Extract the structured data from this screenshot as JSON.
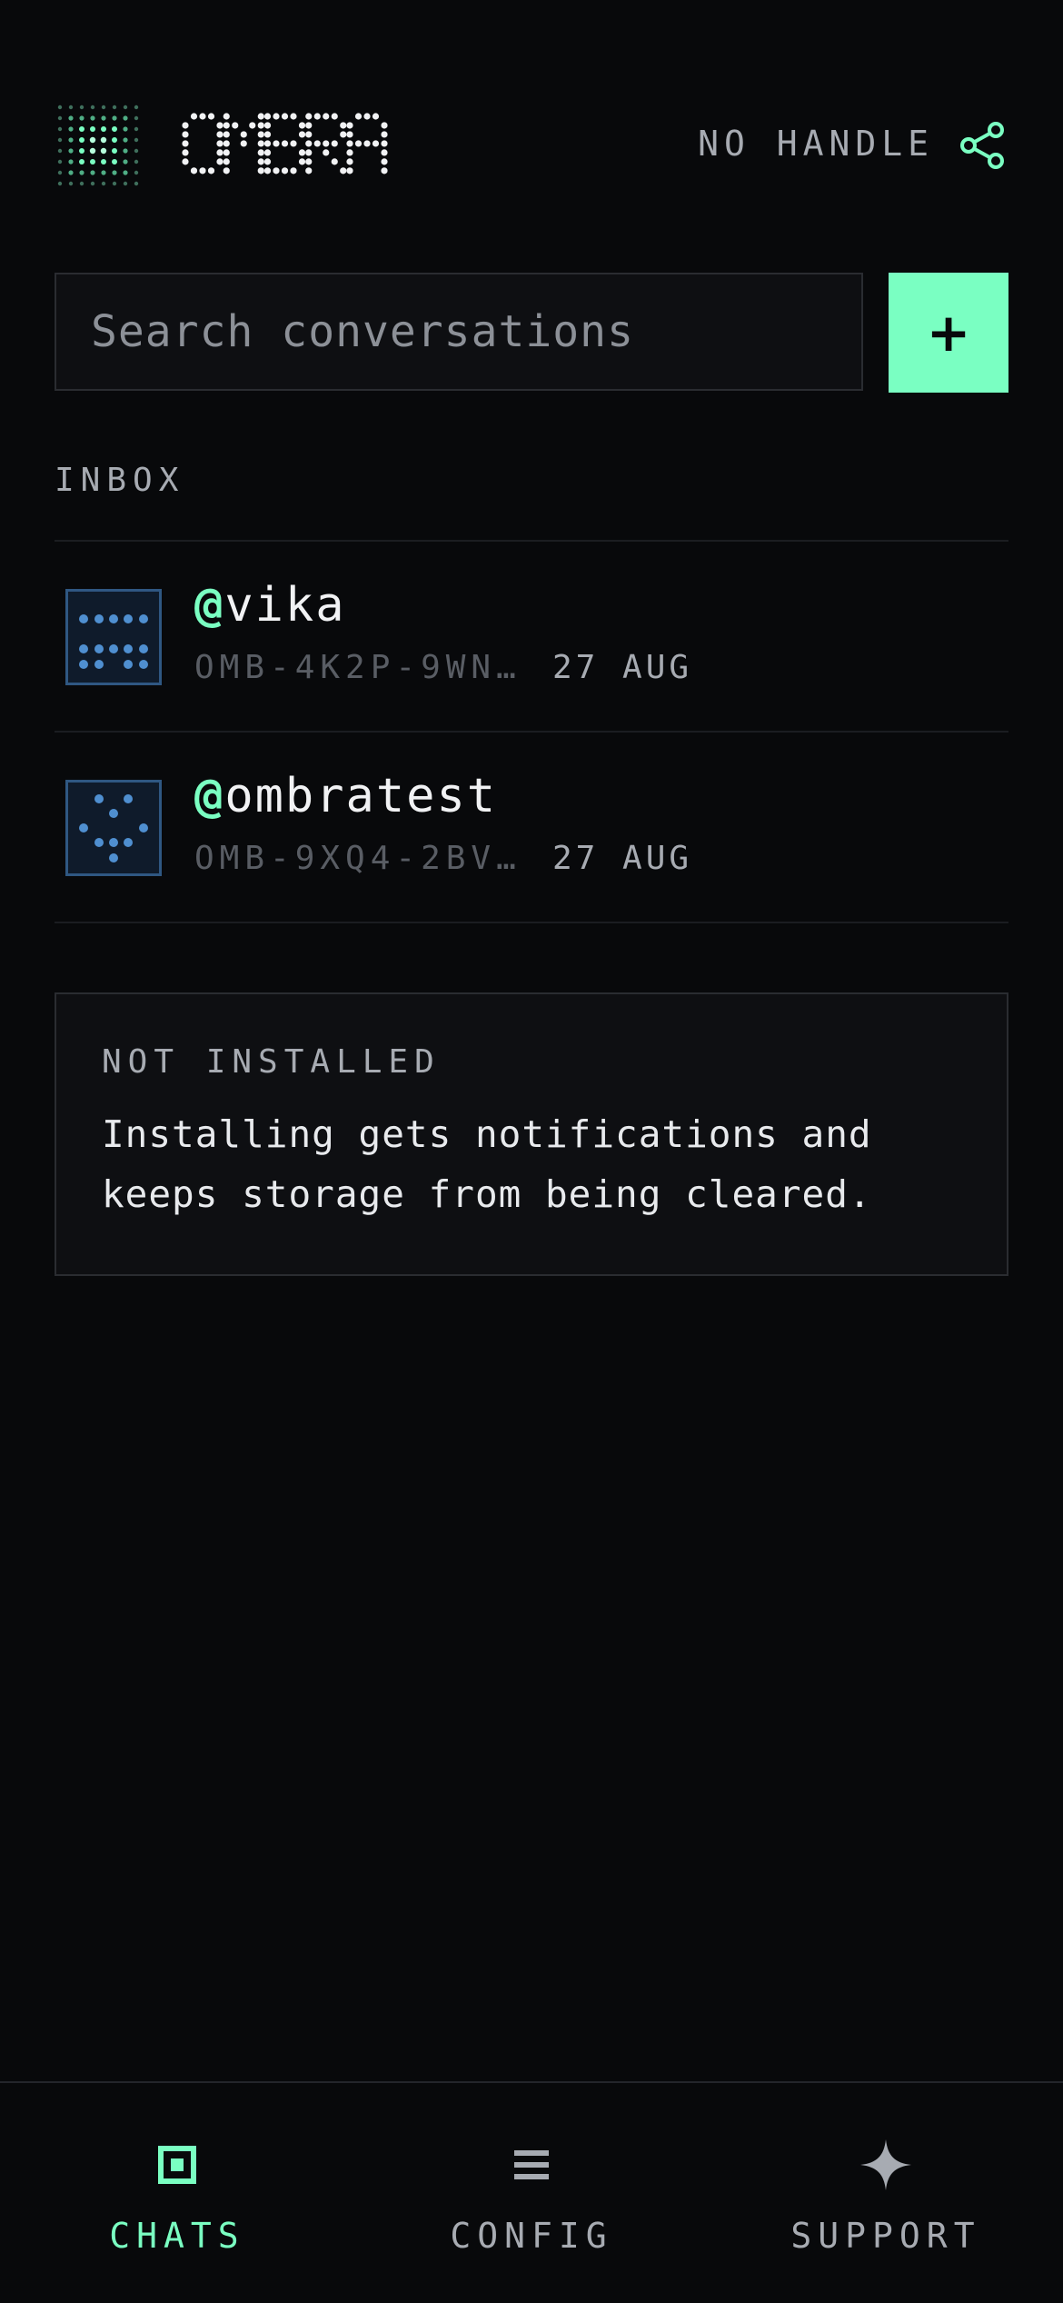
{
  "header": {
    "brand": "OMBRA",
    "handle_label": "NO HANDLE",
    "share_icon": "share-icon",
    "accent_color": "#7affc2"
  },
  "search": {
    "placeholder": "Search conversations",
    "value": "",
    "new_button_label": "+"
  },
  "inbox": {
    "label": "INBOX",
    "conversations": [
      {
        "at": "@",
        "name": "vika",
        "id": "OMB-4K2P-9WNR-…",
        "date": "27 AUG"
      },
      {
        "at": "@",
        "name": "ombratest",
        "id": "OMB-9XQ4-2BVT-…",
        "date": "27 AUG"
      }
    ]
  },
  "notice": {
    "title": "NOT INSTALLED",
    "body": "Installing gets notifications and keeps storage from being cleared."
  },
  "nav": {
    "items": [
      {
        "label": "CHATS",
        "icon": "chat-square-icon",
        "active": true
      },
      {
        "label": "CONFIG",
        "icon": "menu-lines-icon",
        "active": false
      },
      {
        "label": "SUPPORT",
        "icon": "sparkle-icon",
        "active": false
      }
    ]
  }
}
